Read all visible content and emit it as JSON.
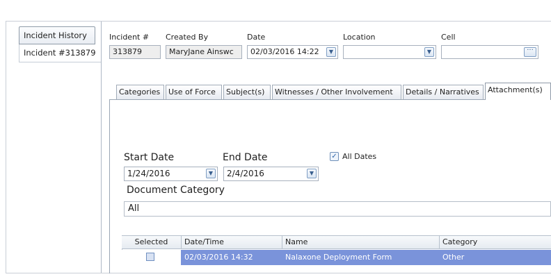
{
  "left_tabs": {
    "history_label": "Incident History",
    "incident_label": "Incident #313879"
  },
  "header": {
    "incident_label": "Incident #",
    "incident_value": "313879",
    "created_by_label": "Created By",
    "created_by_value": "MaryJane  Ainswc",
    "date_label": "Date",
    "date_value": "02/03/2016 14:22",
    "location_label": "Location",
    "location_value": "",
    "cell_label": "Cell",
    "cell_value": ""
  },
  "tabs": [
    {
      "label": "Categories"
    },
    {
      "label": "Use of Force"
    },
    {
      "label": "Subject(s)"
    },
    {
      "label": "Witnesses / Other Involvement"
    },
    {
      "label": "Details / Narratives"
    },
    {
      "label": "Attachment(s)"
    }
  ],
  "active_tab": "Attachment(s)",
  "filters": {
    "start_date_label": "Start Date",
    "start_date_value": "1/24/2016",
    "end_date_label": "End Date",
    "end_date_value": "2/4/2016",
    "all_dates_label": "All Dates",
    "all_dates_checked": true,
    "doc_category_label": "Document Category",
    "doc_category_value": "All"
  },
  "grid": {
    "columns": [
      "Selected",
      "Date/Time",
      "Name",
      "Category"
    ],
    "rows": [
      {
        "selected": false,
        "datetime": "02/03/2016 14:32",
        "name": "Nalaxone Deployment Form",
        "category": "Other"
      }
    ]
  },
  "colors": {
    "selected_row": "#7a93da",
    "tab_border": "#a0abb8"
  }
}
